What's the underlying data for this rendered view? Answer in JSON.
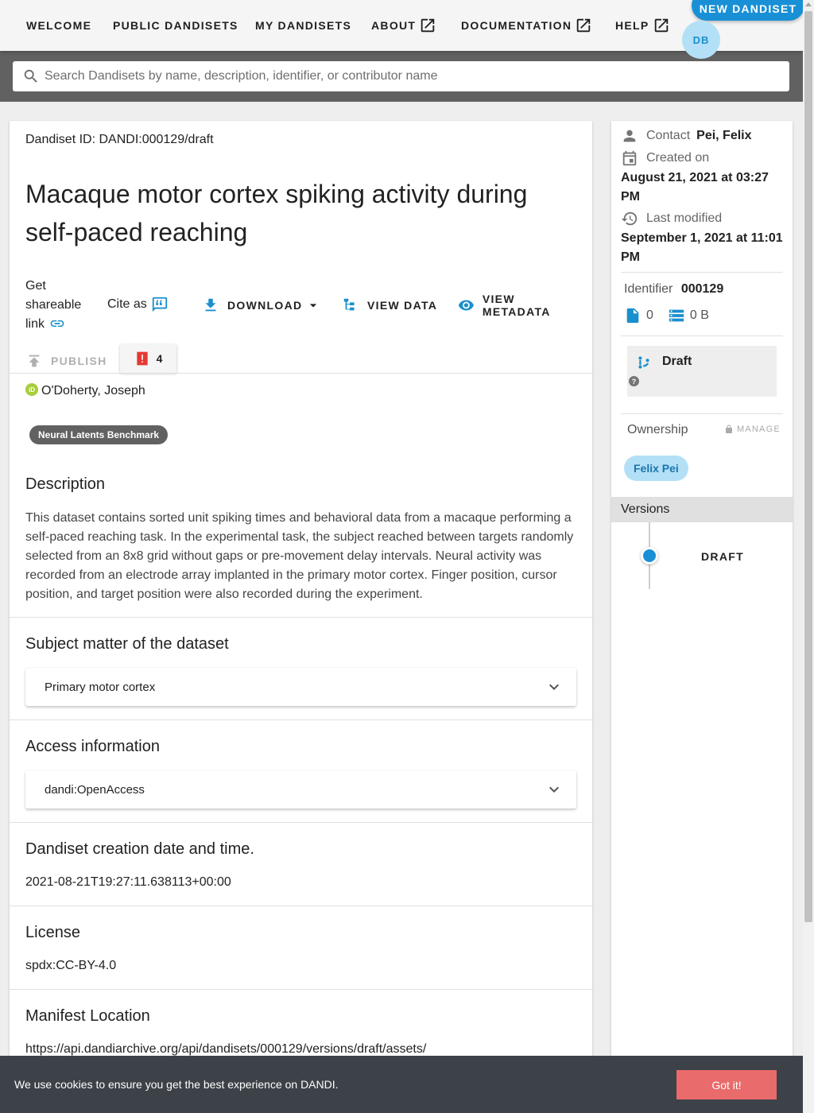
{
  "nav": {
    "items": [
      {
        "label": "WELCOME"
      },
      {
        "label": "PUBLIC DANDISETS"
      },
      {
        "label": "MY DANDISETS"
      },
      {
        "label": "ABOUT"
      },
      {
        "label": "DOCUMENTATION"
      },
      {
        "label": "HELP"
      }
    ],
    "new_button": "NEW DANDISET",
    "avatar_initials": "DB"
  },
  "search": {
    "placeholder": "Search Dandisets by name, description, identifier, or contributor name"
  },
  "dandiset": {
    "id_line": "Dandiset ID: DANDI:000129/draft",
    "title": "Macaque motor cortex spiking activity during self-paced reaching",
    "actions": {
      "share_label": "Get shareable link",
      "cite_label": "Cite as",
      "download_label": "DOWNLOAD",
      "view_data_label": "VIEW DATA",
      "view_metadata_label": "VIEW METADATA",
      "publish_label": "PUBLISH",
      "warning_count": "4"
    },
    "contributor": "O'Doherty, Joseph",
    "orcid_badge": "iD",
    "chip": "Neural Latents Benchmark",
    "sections": {
      "description_heading": "Description",
      "description": "This dataset contains sorted unit spiking times and behavioral data from a macaque performing a self-paced reaching task. In the experimental task, the subject reached between targets randomly selected from an 8x8 grid without gaps or pre-movement delay intervals. Neural activity was recorded from an electrode array implanted in the primary motor cortex. Finger position, cursor position, and target position were also recorded during the experiment.",
      "subject_heading": "Subject matter of the dataset",
      "subject_value": "Primary motor cortex",
      "access_heading": "Access information",
      "access_value": "dandi:OpenAccess",
      "creation_heading": "Dandiset creation date and time.",
      "creation_value": "2021-08-21T19:27:11.638113+00:00",
      "license_heading": "License",
      "license_value": "spdx:CC-BY-4.0",
      "manifest_heading": "Manifest Location",
      "manifest_value": "https://api.dandiarchive.org/api/dandisets/000129/versions/draft/assets/"
    }
  },
  "sidebar": {
    "contact_label": "Contact",
    "contact_value": "Pei, Felix",
    "created_label": "Created on",
    "created_value": "August 21, 2021 at 03:27 PM",
    "modified_label": "Last modified",
    "modified_value": "September 1, 2021 at 11:01 PM",
    "identifier_label": "Identifier",
    "identifier_value": "000129",
    "file_count": "0",
    "size": "0 B",
    "draft_label": "Draft",
    "help_glyph": "?",
    "ownership_label": "Ownership",
    "manage_label": "MANAGE",
    "owner": "Felix Pei",
    "versions_label": "Versions",
    "version_item": "DRAFT"
  },
  "cookie": {
    "text": "We use cookies to ensure you get the best experience on DANDI.",
    "button": "Got it!"
  },
  "colors": {
    "accent": "#1990d6",
    "cookie_bg": "#3d4148",
    "cookie_button": "#e96b6b",
    "warning": "#e53935"
  }
}
